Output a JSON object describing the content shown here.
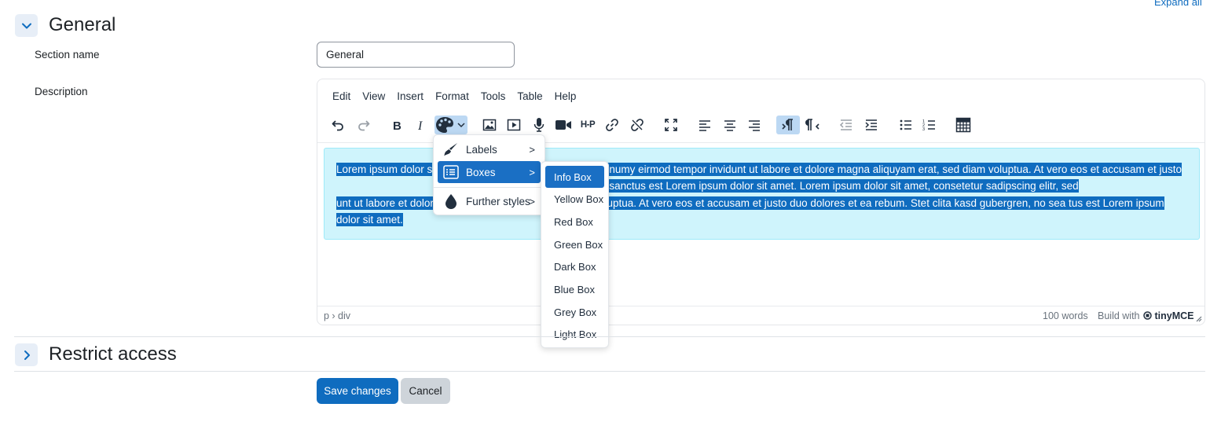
{
  "header": {
    "expand_all": "Expand all"
  },
  "general": {
    "title": "General",
    "section_name_label": "Section name",
    "section_name_value": "General",
    "description_label": "Description"
  },
  "editor": {
    "menubar": [
      "Edit",
      "View",
      "Insert",
      "Format",
      "Tools",
      "Table",
      "Help"
    ],
    "toolbar_icons": [
      "undo-icon",
      "redo-icon",
      "bold-icon",
      "italic-icon",
      "styles-palette-icon",
      "image-icon",
      "media-icon",
      "record-audio-icon",
      "record-video-icon",
      "h5p-icon",
      "link-icon",
      "unlink-icon",
      "fullscreen-icon",
      "align-left-icon",
      "align-center-icon",
      "align-right-icon",
      "ltr-icon",
      "rtl-icon",
      "outdent-icon",
      "indent-icon",
      "bullet-list-icon",
      "numbered-list-icon",
      "equation-icon"
    ],
    "h5p_label": "H-P",
    "content_parts": [
      "Lorem ipsum dolor s",
      ", sed diam nonumy eirmod tempor invidunt ut labore et dolore magna aliquyam erat, sed diam voluptua. At vero eos et accusam et justo",
      "kasd gubergren, no sea takimata sanctus est Lorem ipsum dolor sit amet. Lorem ipsum dolor sit amet, consetetur sadipscing elitr, sed",
      "unt ut labore et dolore magna aliquyam erat, sed diam voluptua. At vero eos et accusam et justo duo dolores et ea rebum. Stet clita kasd gubergren, no sea t",
      "us est Lorem ipsum dolor sit amet."
    ],
    "status_path": "p › div",
    "word_count": "100 words",
    "build_with": "Build with",
    "brand": "tinyMCE"
  },
  "styles_menu": {
    "items": [
      {
        "label": "Labels",
        "icon": "brush-icon"
      },
      {
        "label": "Boxes",
        "icon": "list-box-icon"
      },
      {
        "label": "Further styles",
        "icon": "drop-icon"
      }
    ],
    "arrow": ">"
  },
  "boxes_submenu": {
    "items": [
      "Info Box",
      "Yellow Box",
      "Red Box",
      "Green Box",
      "Dark Box",
      "Blue Box",
      "Grey Box",
      "Light Box"
    ]
  },
  "restrict": {
    "title": "Restrict access"
  },
  "buttons": {
    "save": "Save changes",
    "cancel": "Cancel"
  },
  "colors": {
    "primary": "#0f6cbf",
    "info_box_bg": "#cff4fc",
    "selection": "#0f6cbf"
  }
}
